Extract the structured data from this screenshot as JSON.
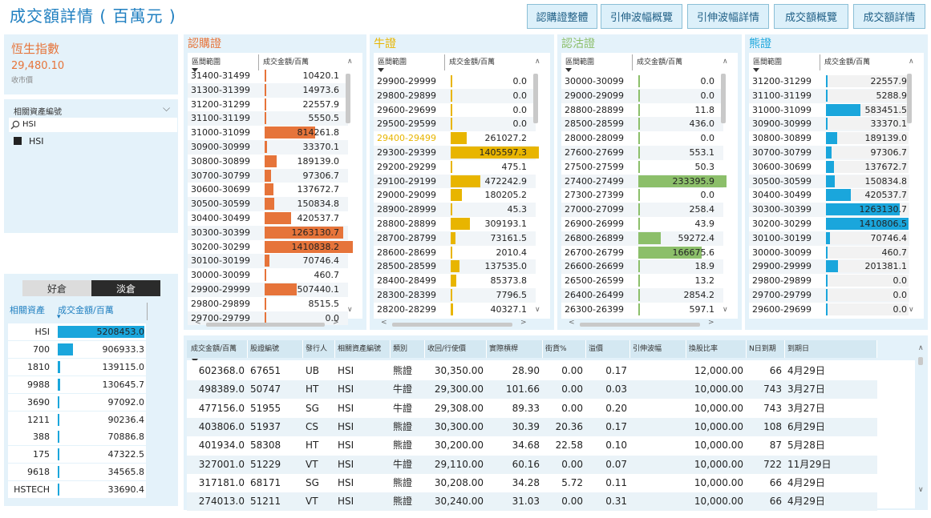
{
  "header": {
    "title": "成交額詳情 ( 百萬元 )",
    "buttons": [
      "認購證整體",
      "引伸波幅概覽",
      "引伸波幅詳情",
      "成交額概覽",
      "成交額詳情"
    ]
  },
  "index_card": {
    "name": "恆生指數",
    "value": "29,480.10",
    "sub": "收市價"
  },
  "filter": {
    "title": "相關資產編號",
    "search_value": "HSI",
    "item": "HSI",
    "chevron": "⌵"
  },
  "asset_tabs": {
    "tabs": [
      "好倉",
      "淡倉"
    ],
    "active": 1,
    "col1": "相關資產",
    "col2": "成交金額/百萬",
    "sort_icon": "▾",
    "rows": [
      {
        "a": "HSI",
        "v": "5208453.0",
        "f": 1.0
      },
      {
        "a": "700",
        "v": "906933.3",
        "f": 0.174
      },
      {
        "a": "1810",
        "v": "139115.0",
        "f": 0.027
      },
      {
        "a": "9988",
        "v": "130645.7",
        "f": 0.025
      },
      {
        "a": "3690",
        "v": "97092.0",
        "f": 0.019
      },
      {
        "a": "1211",
        "v": "90236.4",
        "f": 0.017
      },
      {
        "a": "388",
        "v": "70886.8",
        "f": 0.014
      },
      {
        "a": "175",
        "v": "47322.5",
        "f": 0.009
      },
      {
        "a": "9618",
        "v": "34565.8",
        "f": 0.007
      },
      {
        "a": "HSTECH",
        "v": "33690.4",
        "f": 0.006
      }
    ]
  },
  "sections": [
    {
      "title": "認購證",
      "color": "#e6743a",
      "col1": "區間範圍",
      "col2": "成交金額/百萬",
      "up": "∧",
      "down": "∨",
      "left": "<",
      "right": ">",
      "rows": [
        {
          "r": "31400-31499",
          "v": "10420.1",
          "f": 0.007
        },
        {
          "r": "31300-31399",
          "v": "14973.6",
          "f": 0.011
        },
        {
          "r": "31200-31299",
          "v": "22557.9",
          "f": 0.016
        },
        {
          "r": "31100-31199",
          "v": "5550.5",
          "f": 0.004
        },
        {
          "r": "31000-31099",
          "v": "814261.8",
          "f": 0.577
        },
        {
          "r": "30900-30999",
          "v": "33370.1",
          "f": 0.024
        },
        {
          "r": "30800-30899",
          "v": "189139.0",
          "f": 0.134
        },
        {
          "r": "30700-30799",
          "v": "97306.7",
          "f": 0.069
        },
        {
          "r": "30600-30699",
          "v": "137672.7",
          "f": 0.098
        },
        {
          "r": "30500-30599",
          "v": "150834.8",
          "f": 0.107
        },
        {
          "r": "30400-30499",
          "v": "420537.7",
          "f": 0.298
        },
        {
          "r": "30300-30399",
          "v": "1263130.7",
          "f": 0.895
        },
        {
          "r": "30200-30299",
          "v": "1410838.2",
          "f": 1.0
        },
        {
          "r": "30100-30199",
          "v": "70746.4",
          "f": 0.05
        },
        {
          "r": "30000-30099",
          "v": "460.7",
          "f": 0.0
        },
        {
          "r": "29900-29999",
          "v": "507440.1",
          "f": 0.36
        },
        {
          "r": "29800-29899",
          "v": "8515.5",
          "f": 0.006
        },
        {
          "r": "29700-29799",
          "v": "0.0",
          "f": 0.0
        }
      ]
    },
    {
      "title": "牛證",
      "color": "#e8b500",
      "col1": "區間範圍",
      "col2": "成交金額/百萬",
      "up": "∧",
      "down": "∨",
      "left": "<",
      "right": ">",
      "rows": [
        {
          "r": "29900-29999",
          "v": "0.0",
          "f": 0.0
        },
        {
          "r": "29800-29899",
          "v": "0.0",
          "f": 0.0
        },
        {
          "r": "29600-29699",
          "v": "0.0",
          "f": 0.0
        },
        {
          "r": "29500-29599",
          "v": "0.0",
          "f": 0.0
        },
        {
          "r": "29400-29499",
          "v": "261027.2",
          "f": 0.186,
          "hl": true
        },
        {
          "r": "29300-29399",
          "v": "1405597.3",
          "f": 1.0
        },
        {
          "r": "29200-29299",
          "v": "475.1",
          "f": 0.0
        },
        {
          "r": "29100-29199",
          "v": "472242.9",
          "f": 0.336
        },
        {
          "r": "29000-29099",
          "v": "180205.2",
          "f": 0.128
        },
        {
          "r": "28900-28999",
          "v": "45.3",
          "f": 0.0
        },
        {
          "r": "28800-28899",
          "v": "309193.1",
          "f": 0.22
        },
        {
          "r": "28700-28799",
          "v": "73161.5",
          "f": 0.052
        },
        {
          "r": "28600-28699",
          "v": "2010.4",
          "f": 0.001
        },
        {
          "r": "28500-28599",
          "v": "137535.0",
          "f": 0.098
        },
        {
          "r": "28400-28499",
          "v": "85373.8",
          "f": 0.061
        },
        {
          "r": "28300-28399",
          "v": "7796.5",
          "f": 0.006
        },
        {
          "r": "28200-28299",
          "v": "40327.1",
          "f": 0.029
        }
      ]
    },
    {
      "title": "認沽證",
      "color": "#8cbf6a",
      "col1": "區間範圍",
      "col2": "成交金額/百萬",
      "up": "∧",
      "down": "∨",
      "left": "<",
      "right": ">",
      "rows": [
        {
          "r": "30000-30099",
          "v": "0.0",
          "f": 0.0
        },
        {
          "r": "29000-29099",
          "v": "0.0",
          "f": 0.0
        },
        {
          "r": "28800-28899",
          "v": "11.8",
          "f": 0.0
        },
        {
          "r": "28500-28599",
          "v": "436.0",
          "f": 0.002
        },
        {
          "r": "28000-28099",
          "v": "0.0",
          "f": 0.0
        },
        {
          "r": "27600-27699",
          "v": "553.1",
          "f": 0.002
        },
        {
          "r": "27500-27599",
          "v": "50.3",
          "f": 0.0
        },
        {
          "r": "27400-27499",
          "v": "233395.9",
          "f": 1.0
        },
        {
          "r": "27300-27399",
          "v": "0.0",
          "f": 0.0
        },
        {
          "r": "27000-27099",
          "v": "258.4",
          "f": 0.001
        },
        {
          "r": "26900-26999",
          "v": "43.9",
          "f": 0.0
        },
        {
          "r": "26800-26899",
          "v": "59272.4",
          "f": 0.254
        },
        {
          "r": "26700-26799",
          "v": "166675.6",
          "f": 0.714
        },
        {
          "r": "26600-26699",
          "v": "18.9",
          "f": 0.0
        },
        {
          "r": "26500-26599",
          "v": "13.2",
          "f": 0.0
        },
        {
          "r": "26400-26499",
          "v": "2854.2",
          "f": 0.012
        },
        {
          "r": "26300-26399",
          "v": "597.1",
          "f": 0.003
        }
      ]
    },
    {
      "title": "熊證",
      "color": "#1aa6dc",
      "col1": "區間範圍",
      "col2": "成交金額/百萬",
      "up": "∧",
      "down": "∨",
      "left": "",
      "right": "",
      "rows": [
        {
          "r": "31200-31299",
          "v": "22557.9",
          "f": 0.016
        },
        {
          "r": "31100-31199",
          "v": "5288.9",
          "f": 0.004
        },
        {
          "r": "31000-31099",
          "v": "583451.5",
          "f": 0.414
        },
        {
          "r": "30900-30999",
          "v": "33370.1",
          "f": 0.024
        },
        {
          "r": "30800-30899",
          "v": "189139.0",
          "f": 0.134
        },
        {
          "r": "30700-30799",
          "v": "97306.7",
          "f": 0.069
        },
        {
          "r": "30600-30699",
          "v": "137672.7",
          "f": 0.098
        },
        {
          "r": "30500-30599",
          "v": "150834.8",
          "f": 0.107
        },
        {
          "r": "30400-30499",
          "v": "420537.7",
          "f": 0.298
        },
        {
          "r": "30300-30399",
          "v": "1263130.7",
          "f": 0.895
        },
        {
          "r": "30200-30299",
          "v": "1410806.5",
          "f": 1.0
        },
        {
          "r": "30100-30199",
          "v": "70746.4",
          "f": 0.05
        },
        {
          "r": "30000-30099",
          "v": "460.7",
          "f": 0.0
        },
        {
          "r": "29900-29999",
          "v": "201381.1",
          "f": 0.143
        },
        {
          "r": "29800-29899",
          "v": "0.0",
          "f": 0.0
        },
        {
          "r": "29700-29799",
          "v": "0.0",
          "f": 0.0
        },
        {
          "r": "29600-29699",
          "v": "0.0",
          "f": 0.0
        }
      ]
    }
  ],
  "bottom_table": {
    "headers": [
      "成交金額/百萬",
      "股證編號",
      "發行人",
      "相關資產編號",
      "類別",
      "收回/行使價",
      "實際槓桿",
      "街貨%",
      "溢價",
      "引伸波幅",
      "換股比率",
      "N日到期",
      "到期日"
    ],
    "up": "∧",
    "down": "∨",
    "rows": [
      [
        "602368.0",
        "67651",
        "UB",
        "HSI",
        "熊證",
        "30,350.00",
        "28.90",
        "0.00",
        "0.17",
        "",
        "12,000.00",
        "66",
        "4月29日"
      ],
      [
        "498389.0",
        "50747",
        "HT",
        "HSI",
        "牛證",
        "29,300.00",
        "101.66",
        "0.00",
        "0.03",
        "",
        "10,000.00",
        "743",
        "3月27日"
      ],
      [
        "477156.0",
        "51955",
        "SG",
        "HSI",
        "牛證",
        "29,308.00",
        "89.33",
        "0.00",
        "0.20",
        "",
        "10,000.00",
        "743",
        "3月27日"
      ],
      [
        "403806.0",
        "51937",
        "CS",
        "HSI",
        "熊證",
        "30,300.00",
        "30.39",
        "20.36",
        "0.17",
        "",
        "10,000.00",
        "108",
        "6月29日"
      ],
      [
        "401934.0",
        "58308",
        "HT",
        "HSI",
        "熊證",
        "30,200.00",
        "34.68",
        "22.58",
        "0.10",
        "",
        "10,000.00",
        "87",
        "5月28日"
      ],
      [
        "327001.0",
        "51229",
        "VT",
        "HSI",
        "牛證",
        "29,110.00",
        "60.16",
        "0.00",
        "0.07",
        "",
        "10,000.00",
        "722",
        "11月29日"
      ],
      [
        "317181.0",
        "68171",
        "SG",
        "HSI",
        "熊證",
        "30,208.00",
        "34.28",
        "5.72",
        "0.11",
        "",
        "10,000.00",
        "66",
        "4月29日"
      ],
      [
        "274013.0",
        "51211",
        "VT",
        "HSI",
        "熊證",
        "30,240.00",
        "31.03",
        "0.00",
        "0.31",
        "",
        "10,000.00",
        "66",
        "4月29日"
      ]
    ]
  }
}
